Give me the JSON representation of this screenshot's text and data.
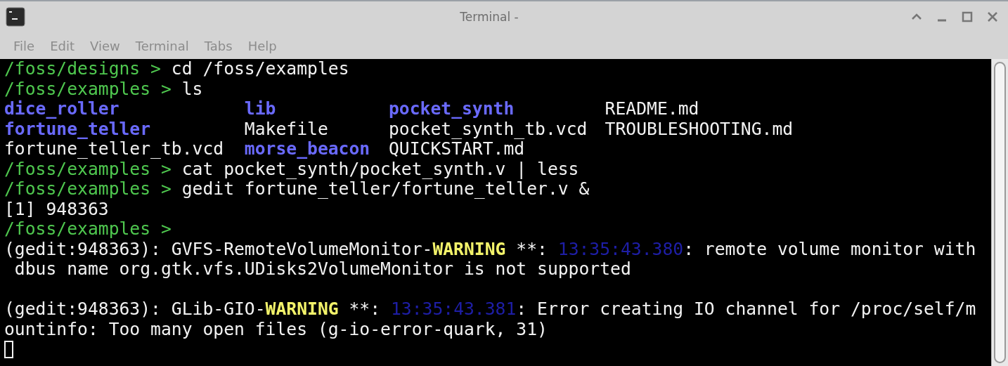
{
  "window": {
    "title": "Terminal -"
  },
  "menu": [
    "File",
    "Edit",
    "View",
    "Terminal",
    "Tabs",
    "Help"
  ],
  "terminal": {
    "lines": [
      {
        "kind": "text",
        "segments": [
          {
            "kind": "prompt",
            "text": "/foss/designs >"
          },
          {
            "kind": "plain",
            "text": " cd /foss/examples"
          }
        ]
      },
      {
        "kind": "text",
        "segments": [
          {
            "kind": "prompt",
            "text": "/foss/examples >"
          },
          {
            "kind": "plain",
            "text": " ls"
          }
        ]
      },
      {
        "kind": "ls",
        "entries": [
          {
            "kind": "dir",
            "text": "dice_roller"
          },
          {
            "kind": "dir",
            "text": "lib"
          },
          {
            "kind": "dir",
            "text": "pocket_synth"
          },
          {
            "kind": "file",
            "text": "README.md"
          }
        ]
      },
      {
        "kind": "ls",
        "entries": [
          {
            "kind": "dir",
            "text": "fortune_teller"
          },
          {
            "kind": "file",
            "text": "Makefile"
          },
          {
            "kind": "file",
            "text": "pocket_synth_tb.vcd"
          },
          {
            "kind": "file",
            "text": "TROUBLESHOOTING.md"
          }
        ]
      },
      {
        "kind": "ls",
        "entries": [
          {
            "kind": "file",
            "text": "fortune_teller_tb.vcd"
          },
          {
            "kind": "dir",
            "text": "morse_beacon"
          },
          {
            "kind": "file",
            "text": "QUICKSTART.md"
          }
        ]
      },
      {
        "kind": "text",
        "segments": [
          {
            "kind": "prompt",
            "text": "/foss/examples >"
          },
          {
            "kind": "plain",
            "text": " cat pocket_synth/pocket_synth.v | less"
          }
        ]
      },
      {
        "kind": "text",
        "segments": [
          {
            "kind": "prompt",
            "text": "/foss/examples >"
          },
          {
            "kind": "plain",
            "text": " gedit fortune_teller/fortune_teller.v &"
          }
        ]
      },
      {
        "kind": "text",
        "segments": [
          {
            "kind": "plain",
            "text": "[1] 948363"
          }
        ]
      },
      {
        "kind": "text",
        "segments": [
          {
            "kind": "prompt",
            "text": "/foss/examples >"
          }
        ]
      },
      {
        "kind": "text",
        "segments": [
          {
            "kind": "plain",
            "text": "(gedit:948363): GVFS-RemoteVolumeMonitor-"
          },
          {
            "kind": "warning",
            "text": "WARNING"
          },
          {
            "kind": "plain",
            "text": " **: "
          },
          {
            "kind": "timestamp",
            "text": "13:35:43.380"
          },
          {
            "kind": "plain",
            "text": ": remote volume monitor with"
          }
        ]
      },
      {
        "kind": "text",
        "segments": [
          {
            "kind": "plain",
            "text": " dbus name org.gtk.vfs.UDisks2VolumeMonitor is not supported"
          }
        ]
      },
      {
        "kind": "blank"
      },
      {
        "kind": "text",
        "segments": [
          {
            "kind": "plain",
            "text": "(gedit:948363): GLib-GIO-"
          },
          {
            "kind": "warning",
            "text": "WARNING"
          },
          {
            "kind": "plain",
            "text": " **: "
          },
          {
            "kind": "timestamp",
            "text": "13:35:43.381"
          },
          {
            "kind": "plain",
            "text": ": Error creating IO channel for /proc/self/m"
          }
        ]
      },
      {
        "kind": "text",
        "segments": [
          {
            "kind": "plain",
            "text": "ountinfo: Too many open files (g-io-error-quark, 31)"
          }
        ]
      },
      {
        "kind": "cursor"
      }
    ]
  }
}
